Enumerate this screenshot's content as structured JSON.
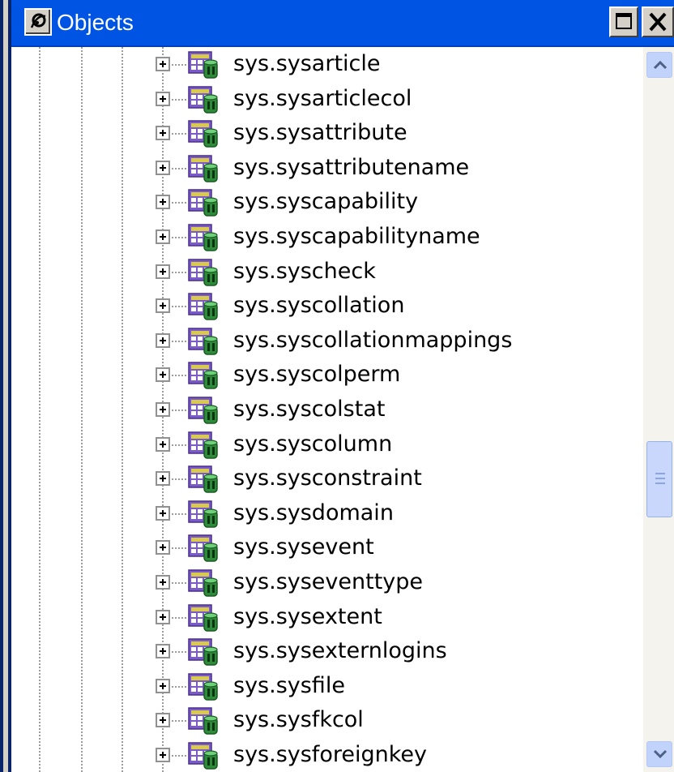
{
  "window": {
    "title": "Objects",
    "icon": "objects-window-icon",
    "buttons": {
      "maximize": "maximize-icon",
      "close": "close-icon"
    }
  },
  "tree": {
    "items": [
      {
        "label": "sys.sysarticle"
      },
      {
        "label": "sys.sysarticlecol"
      },
      {
        "label": "sys.sysattribute"
      },
      {
        "label": "sys.sysattributename"
      },
      {
        "label": "sys.syscapability"
      },
      {
        "label": "sys.syscapabilityname"
      },
      {
        "label": "sys.syscheck"
      },
      {
        "label": "sys.syscollation"
      },
      {
        "label": "sys.syscollationmappings"
      },
      {
        "label": "sys.syscolperm"
      },
      {
        "label": "sys.syscolstat"
      },
      {
        "label": "sys.syscolumn"
      },
      {
        "label": "sys.sysconstraint"
      },
      {
        "label": "sys.sysdomain"
      },
      {
        "label": "sys.sysevent"
      },
      {
        "label": "sys.syseventtype"
      },
      {
        "label": "sys.sysextent"
      },
      {
        "label": "sys.sysexternlogins"
      },
      {
        "label": "sys.sysfile"
      },
      {
        "label": "sys.sysfkcol"
      },
      {
        "label": "sys.sysforeignkey"
      }
    ],
    "item_icon": "system-table-icon",
    "expander_icon": "plus-expander-icon"
  },
  "colors": {
    "titlebar": "#0054e3",
    "text": "#000000",
    "scrollbar_button": "#c1d3fb"
  }
}
